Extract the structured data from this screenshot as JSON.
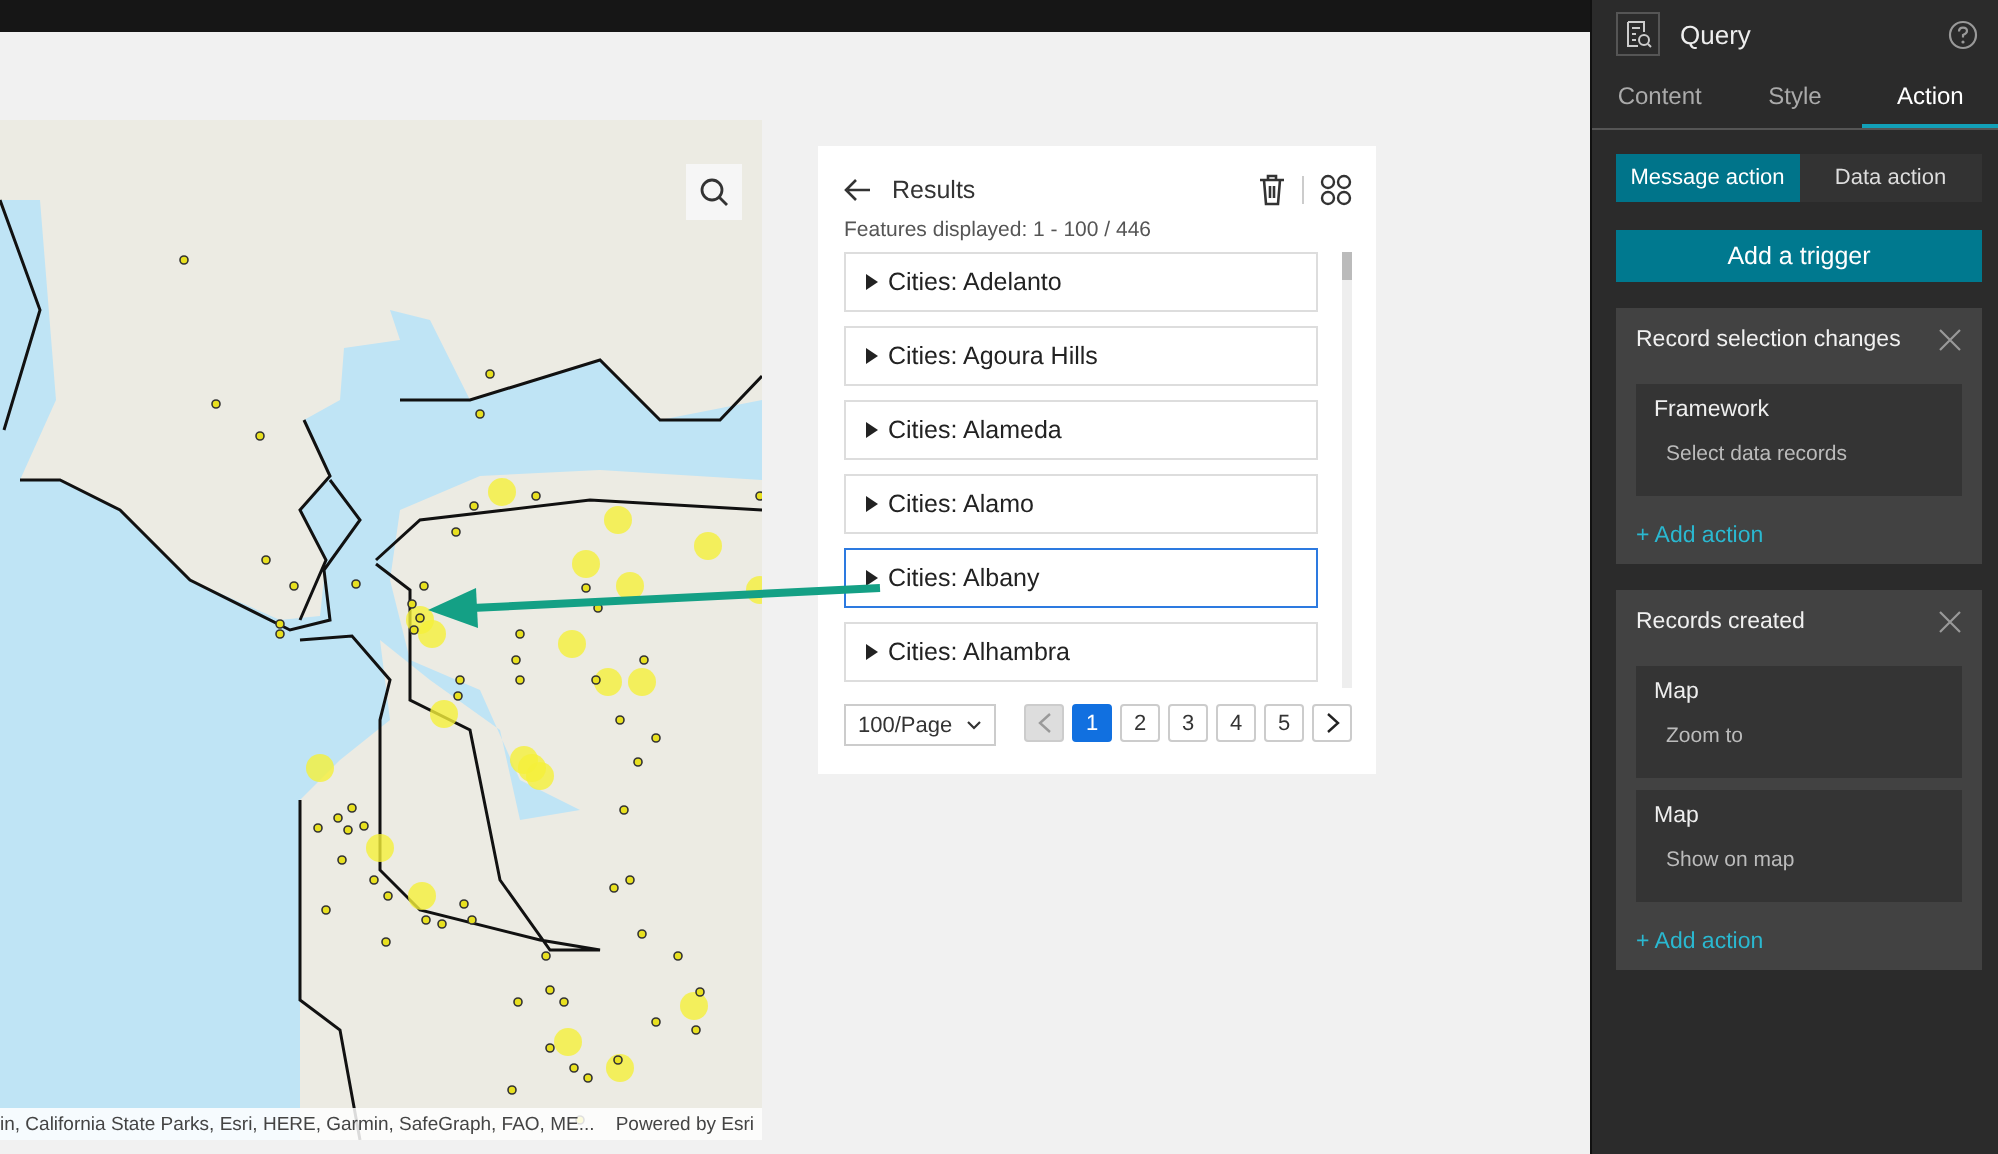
{
  "map": {
    "attribution": "in, California State Parks, Esri, HERE, Garmin, SafeGraph, FAO, ME...",
    "powered_by": "Powered by Esri"
  },
  "results": {
    "title": "Results",
    "summary": "Features displayed: 1 - 100 / 446",
    "items": [
      {
        "label": "Cities: Adelanto",
        "selected": false
      },
      {
        "label": "Cities: Agoura Hills",
        "selected": false
      },
      {
        "label": "Cities: Alameda",
        "selected": false
      },
      {
        "label": "Cities: Alamo",
        "selected": false
      },
      {
        "label": "Cities: Albany",
        "selected": true
      },
      {
        "label": "Cities: Alhambra",
        "selected": false
      }
    ],
    "page_size": "100/Page",
    "prev_disabled": true,
    "pages": [
      {
        "label": "1",
        "selected": true
      },
      {
        "label": "2",
        "selected": false
      },
      {
        "label": "3",
        "selected": false
      },
      {
        "label": "4",
        "selected": false
      },
      {
        "label": "5",
        "selected": false
      }
    ]
  },
  "panel": {
    "title": "Query",
    "tabs": [
      {
        "label": "Content",
        "selected": false
      },
      {
        "label": "Style",
        "selected": false
      },
      {
        "label": "Action",
        "selected": true
      }
    ],
    "action_tabs": [
      {
        "label": "Message action",
        "selected": true
      },
      {
        "label": "Data action",
        "selected": false
      }
    ],
    "add_trigger": "Add a trigger",
    "triggers": [
      {
        "title": "Record selection changes",
        "actions": [
          {
            "target": "Framework",
            "action": "Select data records"
          }
        ],
        "add_action": "+ Add action"
      },
      {
        "title": "Records created",
        "actions": [
          {
            "target": "Map",
            "action": "Zoom to"
          },
          {
            "target": "Map",
            "action": "Show on map"
          }
        ],
        "add_action": "+ Add action"
      }
    ]
  }
}
